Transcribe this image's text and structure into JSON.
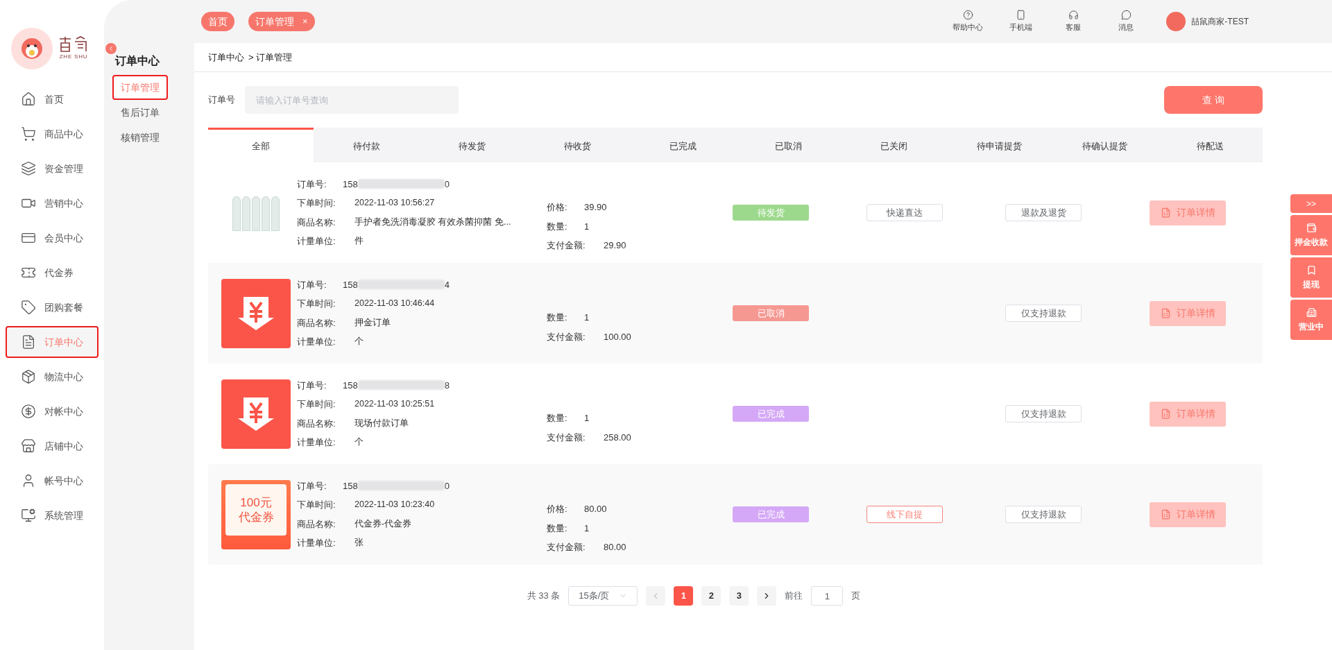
{
  "brand": {
    "name": "ZHE SHU"
  },
  "sidebar": {
    "items": [
      {
        "label": "首页",
        "selected": false
      },
      {
        "label": "商品中心",
        "selected": false
      },
      {
        "label": "资金管理",
        "selected": false
      },
      {
        "label": "营销中心",
        "selected": false
      },
      {
        "label": "会员中心",
        "selected": false
      },
      {
        "label": "代金券",
        "selected": false
      },
      {
        "label": "团购套餐",
        "selected": false
      },
      {
        "label": "订单中心",
        "selected": true
      },
      {
        "label": "物流中心",
        "selected": false
      },
      {
        "label": "对帐中心",
        "selected": false
      },
      {
        "label": "店铺中心",
        "selected": false
      },
      {
        "label": "帐号中心",
        "selected": false
      },
      {
        "label": "系统管理",
        "selected": false
      }
    ]
  },
  "submenu": {
    "title": "订单中心",
    "items": [
      {
        "label": "订单管理",
        "selected": true
      },
      {
        "label": "售后订单",
        "selected": false
      },
      {
        "label": "核销管理",
        "selected": false
      }
    ]
  },
  "open_tabs": [
    {
      "label": "首页",
      "closable": false
    },
    {
      "label": "订单管理",
      "closable": true,
      "close": "×"
    }
  ],
  "header_actions": [
    "帮助中心",
    "手机端",
    "客服",
    "消息"
  ],
  "user": {
    "name": "喆鼠商家-TEST"
  },
  "breadcrumb": [
    "订单中心",
    "> 订单管理"
  ],
  "search": {
    "label": "订单号",
    "placeholder": "请输入订单号查询",
    "button": "查 询"
  },
  "status_tabs": [
    {
      "label": "全部",
      "selected": true
    },
    {
      "label": "待付款",
      "selected": false
    },
    {
      "label": "待发货",
      "selected": false
    },
    {
      "label": "待收货",
      "selected": false
    },
    {
      "label": "已完成",
      "selected": false
    },
    {
      "label": "已取消",
      "selected": false
    },
    {
      "label": "已关闭",
      "selected": false
    },
    {
      "label": "待申请提货",
      "selected": false
    },
    {
      "label": "待确认提货",
      "selected": false
    },
    {
      "label": "待配送",
      "selected": false
    }
  ],
  "orders": [
    {
      "thumbnail": {
        "kind": "photo"
      },
      "order_no": {
        "label": "订单号:",
        "start": "158",
        "end": "0"
      },
      "info": [
        {
          "label": "下单时间:",
          "value": "2022-11-03 10:56:27"
        },
        {
          "label": "商品名称:",
          "value": "手护者免洗消毒凝胶 有效杀菌抑菌 免..."
        },
        {
          "label": "计量单位:",
          "value": "件"
        }
      ],
      "amounts": [
        {
          "label": "价格:",
          "value": "39.90",
          "kind": "short"
        },
        {
          "label": "数量:",
          "value": "1",
          "kind": "short"
        },
        {
          "label": "支付金额:",
          "value": "29.90",
          "kind": "long"
        }
      ],
      "status": {
        "label": "待发货",
        "color": "#9dd98c"
      },
      "delivery": {
        "label": "快递直达",
        "kind": "plain"
      },
      "refund": "退款及退货",
      "detail": "订单详情"
    },
    {
      "thumbnail": {
        "kind": "yuan"
      },
      "order_no": {
        "label": "订单号:",
        "start": "158",
        "end": "4"
      },
      "info": [
        {
          "label": "下单时间:",
          "value": "2022-11-03 10:46:44"
        },
        {
          "label": "商品名称:",
          "value": "押金订单"
        },
        {
          "label": "计量单位:",
          "value": "个"
        }
      ],
      "amounts": [
        {
          "label": "数量:",
          "value": "1",
          "kind": "short"
        },
        {
          "label": "支付金额:",
          "value": "100.00",
          "kind": "long"
        }
      ],
      "status": {
        "label": "已取消",
        "color": "#f59892"
      },
      "refund": "仅支持退款",
      "detail": "订单详情"
    },
    {
      "thumbnail": {
        "kind": "yuan"
      },
      "order_no": {
        "label": "订单号:",
        "start": "158",
        "end": "8"
      },
      "info": [
        {
          "label": "下单时间:",
          "value": "2022-11-03 10:25:51"
        },
        {
          "label": "商品名称:",
          "value": "现场付款订单"
        },
        {
          "label": "计量单位:",
          "value": "个"
        }
      ],
      "amounts": [
        {
          "label": "数量:",
          "value": "1",
          "kind": "short"
        },
        {
          "label": "支付金额:",
          "value": "258.00",
          "kind": "long"
        }
      ],
      "status": {
        "label": "已完成",
        "color": "#d4a8f6"
      },
      "refund": "仅支持退款",
      "detail": "订单详情"
    },
    {
      "thumbnail": {
        "kind": "voucher",
        "lines": [
          "100元",
          "代金券"
        ]
      },
      "order_no": {
        "label": "订单号:",
        "start": "158",
        "end": "0"
      },
      "info": [
        {
          "label": "下单时间:",
          "value": "2022-11-03 10:23:40"
        },
        {
          "label": "商品名称:",
          "value": "代金券-代金券"
        },
        {
          "label": "计量单位:",
          "value": "张"
        }
      ],
      "amounts": [
        {
          "label": "价格:",
          "value": "80.00",
          "kind": "short"
        },
        {
          "label": "数量:",
          "value": "1",
          "kind": "short"
        },
        {
          "label": "支付金额:",
          "value": "80.00",
          "kind": "long"
        }
      ],
      "status": {
        "label": "已完成",
        "color": "#d4a8f6"
      },
      "delivery": {
        "label": "线下自提",
        "kind": "outline"
      },
      "refund": "仅支持退款",
      "detail": "订单详情"
    }
  ],
  "pagination": {
    "total": "共 33 条",
    "page_size": "15条/页",
    "pages": [
      {
        "label": "1",
        "selected": true
      },
      {
        "label": "2",
        "selected": false
      },
      {
        "label": "3",
        "selected": false
      }
    ],
    "goto": "前往",
    "goto_value": "1",
    "goto_unit": "页"
  },
  "float_panel": {
    "toggle": ">>",
    "items": [
      "押金收款",
      "提现",
      "营业中"
    ]
  }
}
